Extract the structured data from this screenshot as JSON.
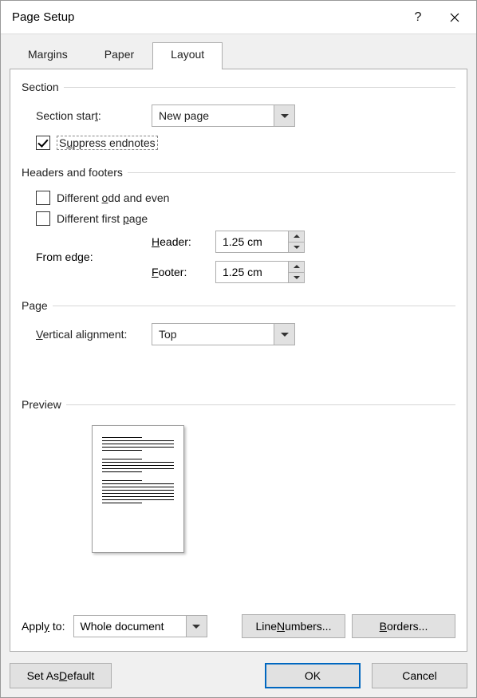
{
  "title": "Page Setup",
  "tabs": {
    "margins": "Margins",
    "paper": "Paper",
    "layout": "Layout"
  },
  "section": {
    "header": "Section",
    "start_label": "Section start:",
    "start_label_u": "t",
    "start_value": "New page",
    "suppress_label": "Suppress endnotes",
    "suppress_label_u": "u",
    "suppress_checked": true
  },
  "hf": {
    "header": "Headers and footers",
    "diff_odd_even": "Different odd and even",
    "diff_odd_even_u": "o",
    "diff_first": "Different first page",
    "diff_first_u": "p",
    "from_edge": "From edge:",
    "header_label": "Header:",
    "header_label_u": "H",
    "header_value": "1.25 cm",
    "footer_label": "Footer:",
    "footer_label_u": "F",
    "footer_value": "1.25 cm"
  },
  "page": {
    "header": "Page",
    "valign_label": "Vertical alignment:",
    "valign_label_u": "V",
    "valign_value": "Top"
  },
  "preview": {
    "header": "Preview"
  },
  "apply": {
    "label": "Apply to:",
    "label_u": "y",
    "value": "Whole document"
  },
  "buttons": {
    "line_numbers": "Line Numbers...",
    "line_numbers_u": "N",
    "borders": "Borders...",
    "borders_u": "B",
    "set_default": "Set As Default",
    "set_default_u": "D",
    "ok": "OK",
    "cancel": "Cancel"
  }
}
